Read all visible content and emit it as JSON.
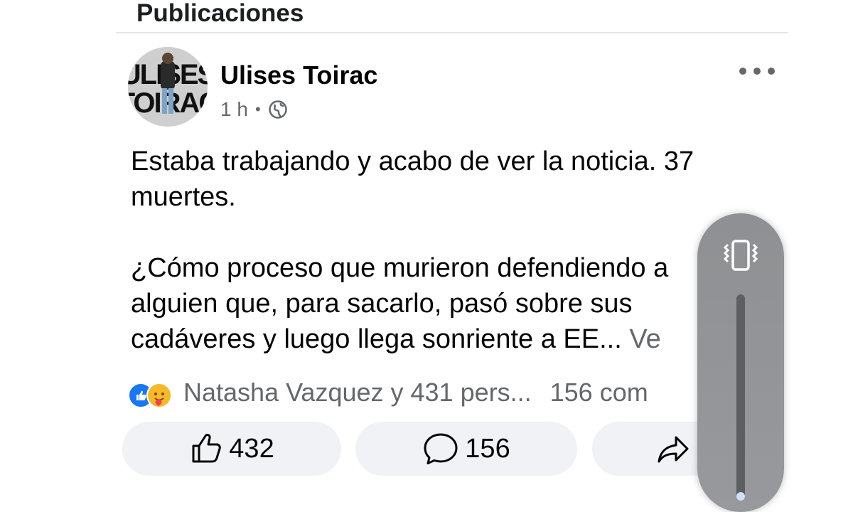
{
  "section": {
    "title": "Publicaciones"
  },
  "post": {
    "author": "Ulises Toirac",
    "time": "1 h",
    "separator": "•",
    "avatar_text": [
      "ULISES",
      "TOIRAC"
    ],
    "paragraphs": [
      "Estaba trabajando y acabo de ver la noticia. 37 muertes.",
      "¿Cómo proceso que murieron defendiendo a alguien que, para sacarlo, pasó sobre sus cadáveres y luego llega sonriente a EE..."
    ],
    "see_more": "Ve",
    "reactions": {
      "names": "Natasha Vazquez y 431 pers...",
      "comments": "156 com"
    },
    "actions": {
      "like_count": "432",
      "comment_count": "156"
    }
  },
  "volume": {
    "level": 0.04
  },
  "colors": {
    "like_blue": "#1877f2",
    "care_yellow": "#f7b928",
    "secondary_text": "#65676b"
  }
}
